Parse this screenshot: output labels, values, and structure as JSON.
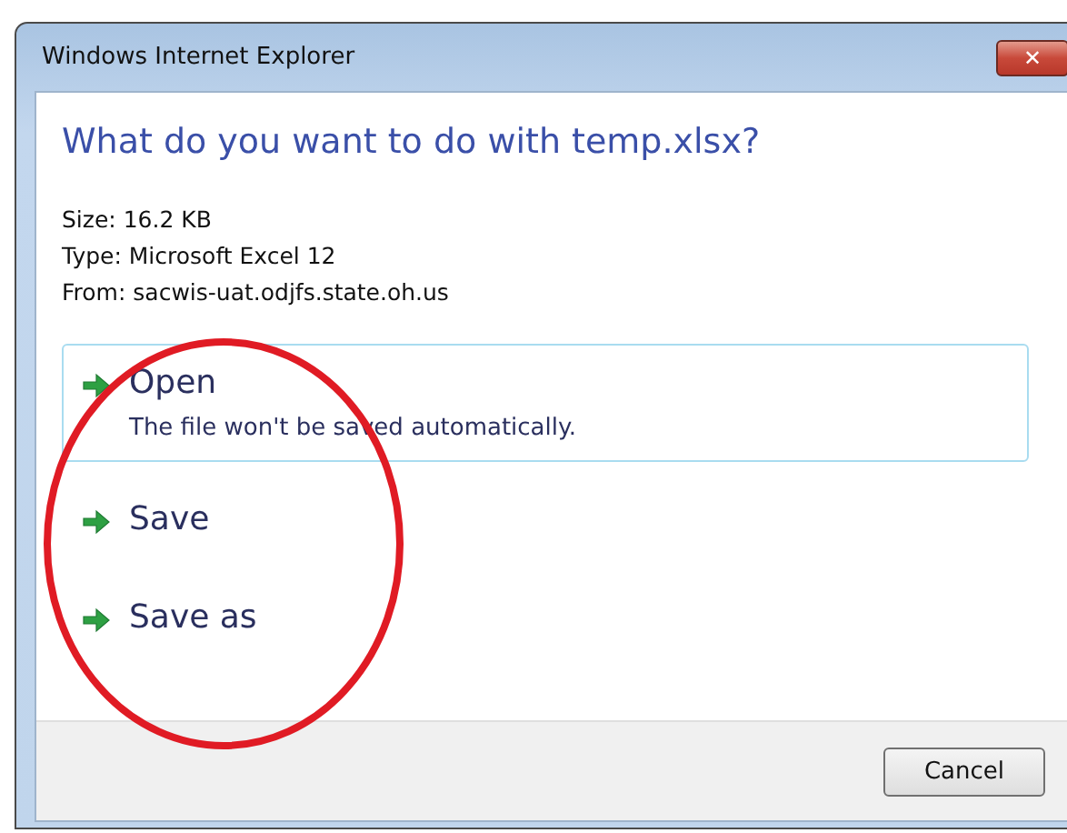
{
  "window": {
    "title": "Windows Internet Explorer",
    "close": "✕"
  },
  "heading": "What do you want to do with temp.xlsx?",
  "details": [
    "Size: 16.2 KB",
    "Type: Microsoft Excel 12",
    "From: sacwis-uat.odjfs.state.oh.us"
  ],
  "options": [
    {
      "label": "Open",
      "description": "The file won't be saved automatically.",
      "selected": true
    },
    {
      "label": "Save",
      "selected": false
    },
    {
      "label": "Save as",
      "selected": false
    }
  ],
  "buttons": [
    "Cancel"
  ]
}
